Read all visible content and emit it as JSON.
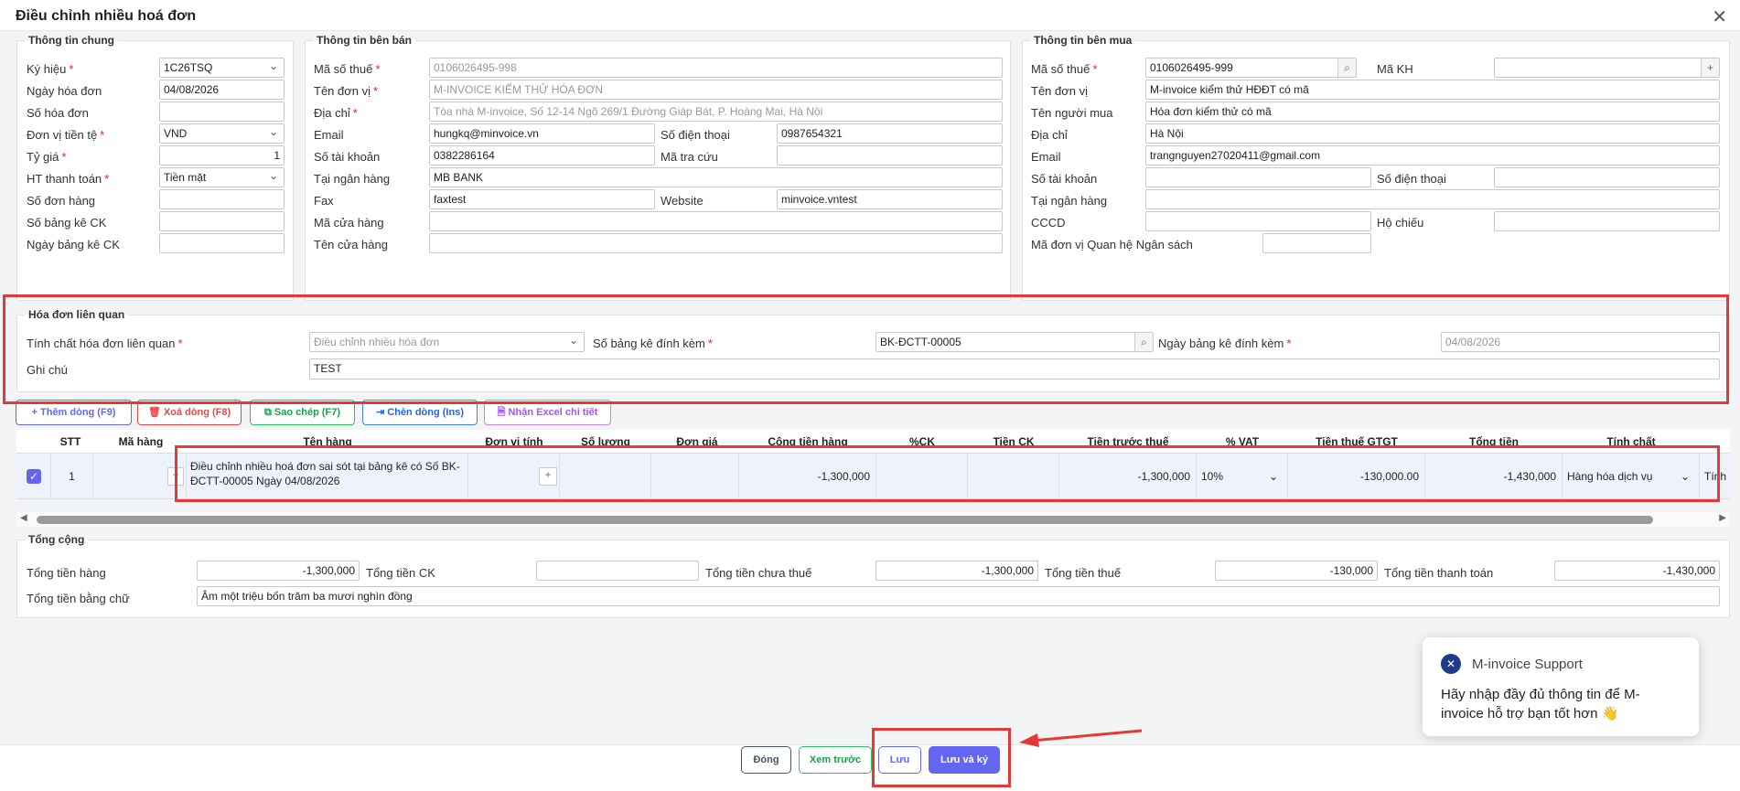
{
  "dialog": {
    "title": "Điều chỉnh nhiều hoá đơn"
  },
  "general": {
    "legend": "Thông tin chung",
    "ky_hieu_label": "Ký hiệu",
    "ky_hieu": "1C26TSQ",
    "ngay_label": "Ngày hóa đơn",
    "ngay": "04/08/2026",
    "so_hd_label": "Số hóa đơn",
    "tien_te_label": "Đơn vị tiền tệ",
    "tien_te": "VND",
    "ty_gia_label": "Tỷ giá",
    "ty_gia": "1",
    "httt_label": "HT thanh toán",
    "httt": "Tiền mặt",
    "so_don_label": "Số đơn hàng",
    "so_bk_label": "Số bảng kê CK",
    "ngay_bk_label": "Ngày bảng kê CK"
  },
  "seller": {
    "legend": "Thông tin bên bán",
    "mst_label": "Mã số thuế",
    "mst": "0106026495-998",
    "ten_label": "Tên đơn vị",
    "ten": "M-INVOICE KIỂM THỬ HÓA ĐƠN",
    "dc_label": "Địa chỉ",
    "dc": "Tòa nhà M-invoice, Số 12-14 Ngõ 269/1 Đường Giáp Bát, P. Hoàng Mai, Hà Nội",
    "email_label": "Email",
    "email": "hungkq@minvoice.vn",
    "sdt_label": "Số điện thoại",
    "sdt": "0987654321",
    "stk_label": "Số tài khoản",
    "stk": "0382286164",
    "matc_label": "Mã tra cứu",
    "nh_label": "Tại ngân hàng",
    "nh": "MB BANK",
    "fax_label": "Fax",
    "fax": "faxtest",
    "web_label": "Website",
    "web": "minvoice.vntest",
    "mach_label": "Mã cửa hàng",
    "tench_label": "Tên cửa hàng"
  },
  "buyer": {
    "legend": "Thông tin bên mua",
    "mst_label": "Mã số thuế",
    "mst": "0106026495-999",
    "makh_label": "Mã KH",
    "ten_label": "Tên đơn vị",
    "ten": "M-invoice kiểm thử HĐĐT có mã",
    "nguoi_label": "Tên người mua",
    "nguoi": "Hóa đơn kiểm thử có mã",
    "dc_label": "Địa chỉ",
    "dc": "Hà Nội",
    "email_label": "Email",
    "email": "trangnguyen27020411@gmail.com",
    "stk_label": "Số tài khoản",
    "sdt_label": "Số điện thoại",
    "nh_label": "Tại ngân hàng",
    "cccd_label": "CCCD",
    "hc_label": "Hộ chiếu",
    "qhns_label": "Mã đơn vị Quan hệ Ngân sách"
  },
  "related": {
    "legend": "Hóa đơn liên quan",
    "tinh_chat_label": "Tính chất hóa đơn liên quan",
    "tinh_chat": "Điều chỉnh nhiều hóa đơn",
    "so_bk_label": "Số bảng kê đính kèm",
    "so_bk": "BK-ĐCTT-00005",
    "ngay_bk_label": "Ngày bảng kê đính kèm",
    "ngay_bk": "04/08/2026",
    "ghi_chu_label": "Ghi chú",
    "ghi_chu": "TEST"
  },
  "toolbar": {
    "them": "Thêm dòng (F9)",
    "xoa": "Xoá dòng (F8)",
    "sao_chep": "Sao chép (F7)",
    "chen": "Chèn dòng (Ins)",
    "excel": "Nhận Excel chi tiết"
  },
  "grid": {
    "headers": [
      "STT",
      "Mã hàng",
      "Tên hàng",
      "Đơn vị tính",
      "Số lượng",
      "Đơn giá",
      "Cộng tiền hàng",
      "%CK",
      "Tiền CK",
      "Tiền trước thuế",
      "% VAT",
      "Tiền thuế GTGT",
      "Tổng tiền",
      "Tính chất"
    ],
    "row": {
      "stt": "1",
      "ten_hang": "Điều chỉnh nhiều hoá đơn sai sót tại bảng kê có Số BK-ĐCTT-00005 Ngày 04/08/2026",
      "cong_tien": "-1,300,000",
      "truoc_thue": "-1,300,000",
      "vat": "10%",
      "thue": "-130,000.00",
      "tong": "-1,430,000",
      "tinh_chat": "Hàng hóa dịch vụ",
      "extra": "Tính"
    }
  },
  "totals": {
    "legend": "Tổng cộng",
    "tien_hang_label": "Tổng tiền hàng",
    "tien_hang": "-1,300,000",
    "ck_label": "Tổng tiền CK",
    "chua_thue_label": "Tổng tiền chưa thuế",
    "chua_thue": "-1,300,000",
    "thue_label": "Tổng tiền thuế",
    "thue": "-130,000",
    "thanh_toan_label": "Tổng tiền thanh toán",
    "thanh_toan": "-1,430,000",
    "bang_chu_label": "Tổng tiền bằng chữ",
    "bang_chu": "Âm một triệu bốn trăm ba mươi nghìn đồng"
  },
  "footer": {
    "dong": "Đóng",
    "xem_truoc": "Xem trước",
    "luu": "Lưu",
    "luu_ky": "Lưu và ký"
  },
  "support": {
    "title": "M-invoice Support",
    "message": "Hãy nhập đầy đủ thông tin để M-invoice hỗ trợ bạn tốt hơn 👋"
  },
  "colors": {
    "accent": "#6366f1",
    "annotation": "#e53935"
  }
}
